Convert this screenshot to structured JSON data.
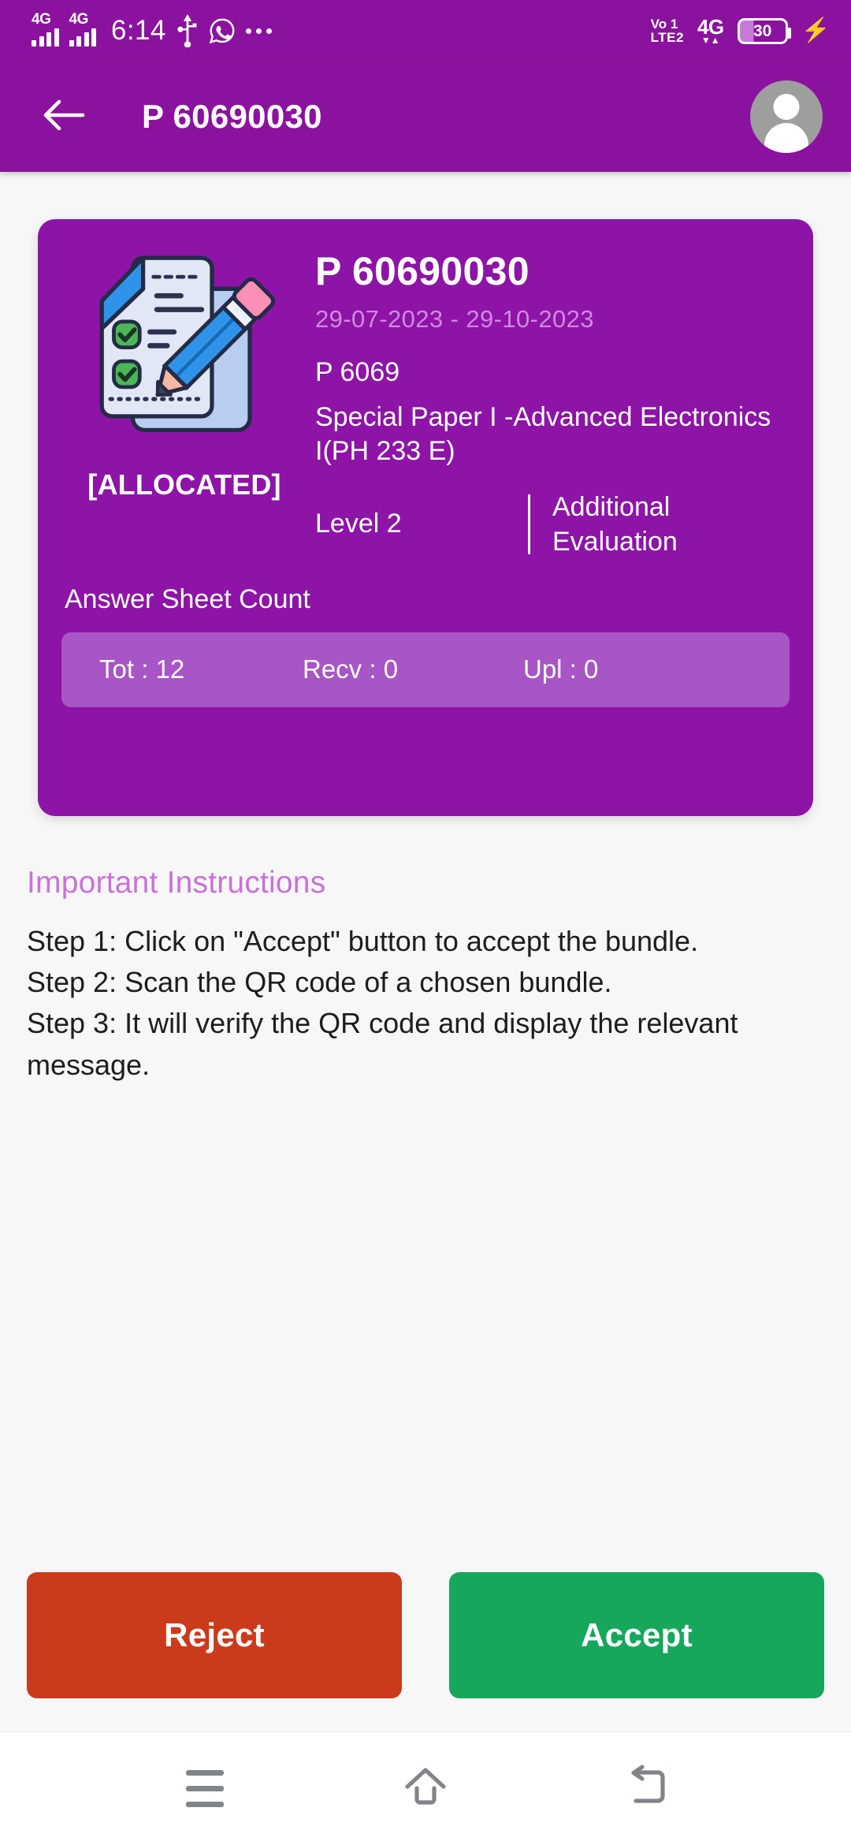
{
  "status_bar": {
    "network_label_1": "4G",
    "network_label_2": "4G",
    "time": "6:14",
    "usb_icon": "usb-icon",
    "whatsapp_icon": "whatsapp-icon",
    "more_icon": "more-notifications-icon",
    "volte_line1": "Vo 1",
    "volte_line2": "LTE2",
    "data_network": "4G",
    "data_arrows": "▼▲",
    "battery_percent": "30",
    "charging_icon": "⚡"
  },
  "app_bar": {
    "back_icon": "back-arrow-icon",
    "title": "P 60690030",
    "avatar_icon": "user-avatar-icon"
  },
  "card": {
    "doc_icon": "document-checklist-pencil-icon",
    "status_badge": "[ALLOCATED]",
    "bundle_number": "P 60690030",
    "date_from": "29-07-2023",
    "date_separator": "-",
    "date_to": "29-10-2023",
    "date_range": "29-07-2023  -  29-10-2023",
    "paper_code": "P 6069",
    "paper_name": "Special Paper I -Advanced Electronics I(PH 233 E)",
    "level": "Level 2",
    "evaluation_type": "Additional Evaluation",
    "answer_sheet_count_label": "Answer Sheet Count",
    "counts": {
      "total": "Tot : 12",
      "received": "Recv : 0",
      "uploaded": "Upl : 0"
    }
  },
  "instructions": {
    "title": "Important Instructions",
    "body": "Step 1: Click on \"Accept\" button to accept the bundle.\nStep 2: Scan the QR code of a chosen bundle.\nStep 3: It will verify the QR code and display the relevant message."
  },
  "actions": {
    "reject_label": "Reject",
    "accept_label": "Accept"
  },
  "nav_bar": {
    "recents_icon": "recents-menu-icon",
    "home_icon": "home-icon",
    "back_icon": "back-nav-icon"
  },
  "colors": {
    "brand_purple": "#8b129e",
    "card_purple": "#8d14a7",
    "pill_purple": "#a855c5",
    "date_text": "#cf8ade",
    "instr_title": "#c972d8",
    "reject_red": "#cb3a1b",
    "accept_green": "#16a75c",
    "page_background": "#f7f7f8"
  }
}
